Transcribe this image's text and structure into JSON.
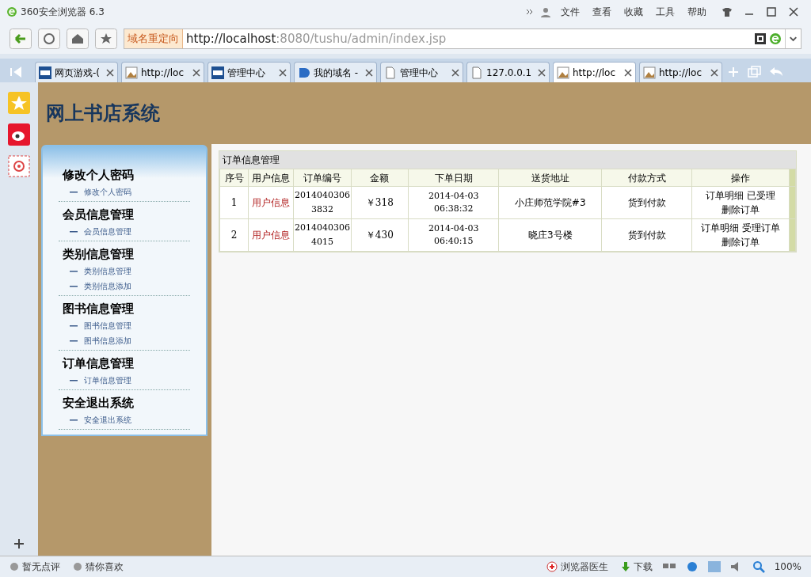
{
  "window": {
    "title": "360安全浏览器 6.3",
    "menu": [
      "文件",
      "查看",
      "收藏",
      "工具",
      "帮助"
    ]
  },
  "address_bar": {
    "badge": "域名重定向",
    "url_host": "http://localhost",
    "url_rest": ":8080/tushu/admin/index.jsp"
  },
  "tabs": [
    {
      "label": "网页游戏-(",
      "kind": "logo",
      "selected": false
    },
    {
      "label": "http://loc",
      "kind": "image",
      "selected": false
    },
    {
      "label": "管理中心",
      "kind": "logo",
      "selected": false
    },
    {
      "label": "我的域名 -",
      "kind": "d",
      "selected": false
    },
    {
      "label": "管理中心",
      "kind": "page",
      "selected": false
    },
    {
      "label": "127.0.0.1",
      "kind": "page",
      "selected": false
    },
    {
      "label": "http://loc",
      "kind": "image",
      "selected": true
    },
    {
      "label": "http://loc",
      "kind": "image",
      "selected": false
    }
  ],
  "page": {
    "site_title": "网上书店系统",
    "menu": [
      {
        "heading": "修改个人密码",
        "items": [
          "修改个人密码"
        ]
      },
      {
        "heading": "会员信息管理",
        "items": [
          "会员信息管理"
        ]
      },
      {
        "heading": "类别信息管理",
        "items": [
          "类别信息管理",
          "类别信息添加"
        ]
      },
      {
        "heading": "图书信息管理",
        "items": [
          "图书信息管理",
          "图书信息添加"
        ]
      },
      {
        "heading": "订单信息管理",
        "items": [
          "订单信息管理"
        ]
      },
      {
        "heading": "安全退出系统",
        "items": [
          "安全退出系统"
        ]
      }
    ],
    "table": {
      "title": "订单信息管理",
      "columns": [
        "序号",
        "用户信息",
        "订单编号",
        "金额",
        "下单日期",
        "送货地址",
        "付款方式",
        "操作"
      ],
      "rows": [
        {
          "no": "1",
          "user": "用户信息",
          "order_no": "20140403063832",
          "amount": "￥318",
          "date": "2014-04-03 06:38:32",
          "address": "小庄师范学院#3",
          "payment": "货到付款",
          "actions": [
            "订单明细",
            "已受理",
            "删除订单"
          ]
        },
        {
          "no": "2",
          "user": "用户信息",
          "order_no": "20140403064015",
          "amount": "￥430",
          "date": "2014-04-03 06:40:15",
          "address": "晓庄3号楼",
          "payment": "货到付款",
          "actions": [
            "订单明细",
            "受理订单",
            "删除订单"
          ]
        }
      ]
    }
  },
  "status_bar": {
    "left": [
      "暂无点评",
      "猜你喜欢"
    ],
    "right": [
      "浏览器医生",
      "下载"
    ],
    "zoom": "100%"
  }
}
